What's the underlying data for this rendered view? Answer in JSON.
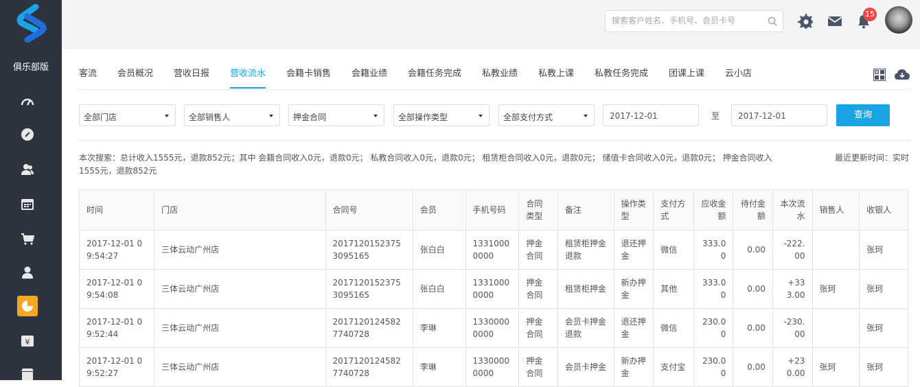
{
  "app": {
    "club_label": "俱乐部版"
  },
  "sidebar": {
    "items": [
      {
        "icon": "dashboard-icon"
      },
      {
        "icon": "compass-icon"
      },
      {
        "icon": "members-icon"
      },
      {
        "icon": "calendar-icon"
      },
      {
        "icon": "cart-icon"
      },
      {
        "icon": "user-icon"
      },
      {
        "icon": "report-pie-icon",
        "active": true
      },
      {
        "icon": "yen-icon"
      },
      {
        "icon": "store-icon"
      }
    ]
  },
  "header": {
    "search_placeholder": "搜索客户姓名、手机号、会员卡号",
    "notification_count": "15"
  },
  "tabs": [
    "客流",
    "会员概况",
    "营收日报",
    "营收流水",
    "会籍卡销售",
    "会籍业绩",
    "会籍任务完成",
    "私教业绩",
    "私教上课",
    "私教任务完成",
    "团课上课",
    "云小店"
  ],
  "active_tab": "营收流水",
  "filters": {
    "store": "全部门店",
    "salesperson": "全部销售人",
    "contract": "押金合同",
    "operation": "全部操作类型",
    "payment": "全部支付方式",
    "date_from": "2017-12-01",
    "to_label": "至",
    "date_to": "2017-12-01",
    "query_label": "查询"
  },
  "summary": "本次搜索：总计收入1555元，退款852元；其中 会籍合同收入0元，退款0元； 私教合同收入0元，退款0元； 租赁柜合同收入0元，退款0元； 储值卡合同收入0元，退款0元； 押金合同收入1555元，退款852元",
  "updated": "最近更新时间：实时",
  "table": {
    "headers": [
      "时间",
      "门店",
      "合同号",
      "会员",
      "手机号码",
      "合同类型",
      "备注",
      "操作类型",
      "支付方式",
      "应收金额",
      "待付金额",
      "本次流水",
      "销售人",
      "收银人"
    ],
    "rows": [
      [
        "2017-12-01 09:54:27",
        "三体云动广州店",
        "20171201523753095165",
        "张白白",
        "13310000000",
        "押金合同",
        "租赁柜押金退款",
        "退还押金",
        "微信",
        "333.00",
        "0.00",
        "-222.00",
        "",
        "张珂"
      ],
      [
        "2017-12-01 09:54:08",
        "三体云动广州店",
        "20171201523753095165",
        "张白白",
        "13310000000",
        "押金合同",
        "租赁柜押金",
        "新办押金",
        "其他",
        "333.00",
        "0.00",
        "+333.00",
        "张珂",
        "张珂"
      ],
      [
        "2017-12-01 09:52:44",
        "三体云动广州店",
        "20171201245827740728",
        "李琳",
        "13300000000",
        "押金合同",
        "会员卡押金退款",
        "退还押金",
        "微信",
        "230.00",
        "0.00",
        "-230.00",
        "",
        "张珂"
      ],
      [
        "2017-12-01 09:52:27",
        "三体云动广州店",
        "20171201245827740728",
        "李琳",
        "13300000000",
        "押金合同",
        "会员卡押金",
        "新办押金",
        "支付宝",
        "230.00",
        "0.00",
        "+230.00",
        "张珂",
        "张珂"
      ]
    ]
  }
}
